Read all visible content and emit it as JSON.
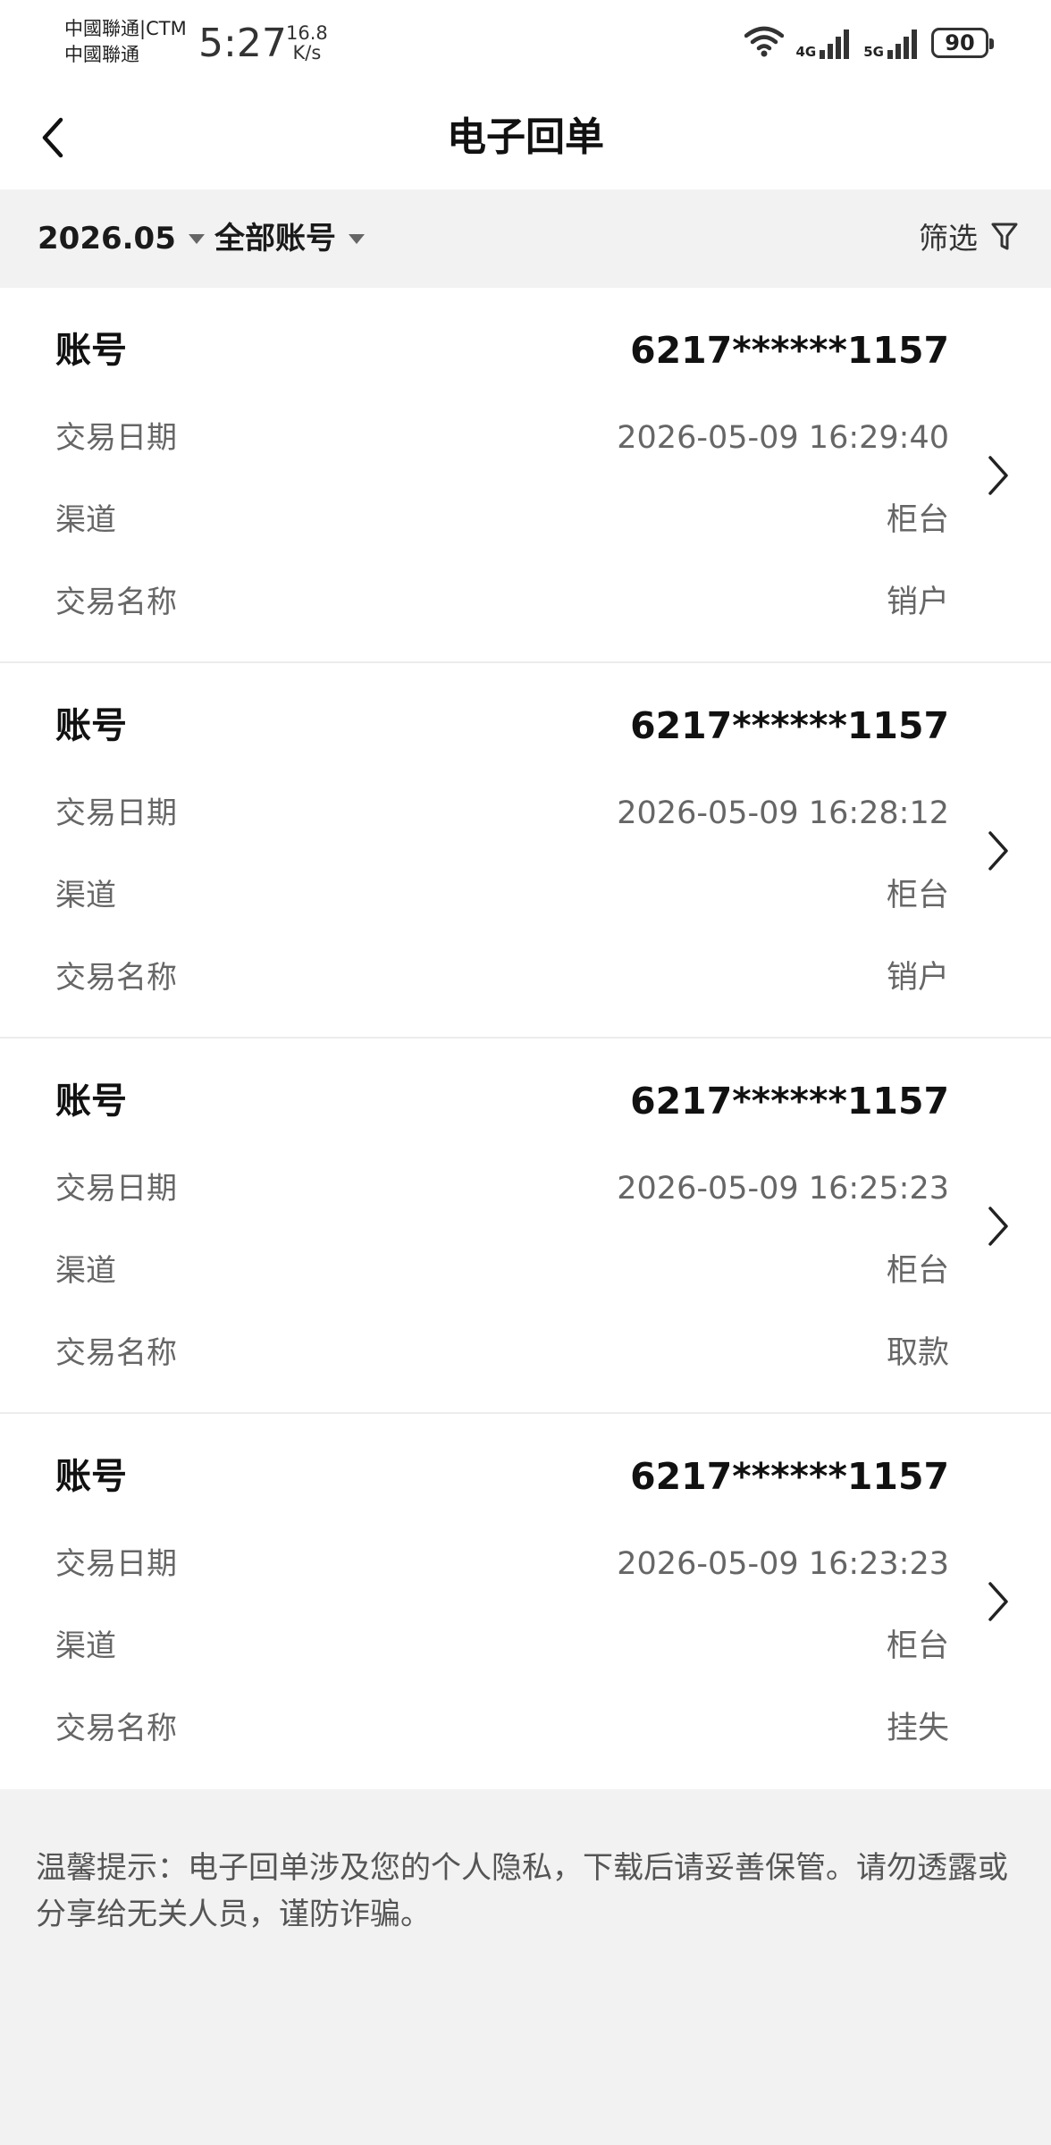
{
  "status_bar": {
    "carrier_1": "中國聯通|CTM",
    "carrier_2": "中國聯通",
    "time": "5:27",
    "speed_value": "16.8",
    "speed_unit": "K/s",
    "net_4g": "4G",
    "net_5g": "5G",
    "battery": "90"
  },
  "header": {
    "title": "电子回单"
  },
  "filters": {
    "month": "2026.05",
    "account": "全部账号",
    "filter_label": "筛选"
  },
  "labels": {
    "account": "账号",
    "date": "交易日期",
    "channel": "渠道",
    "name": "交易名称"
  },
  "records": [
    {
      "account": "6217******1157",
      "date": "2026-05-09 16:29:40",
      "channel": "柜台",
      "name": "销户"
    },
    {
      "account": "6217******1157",
      "date": "2026-05-09 16:28:12",
      "channel": "柜台",
      "name": "销户"
    },
    {
      "account": "6217******1157",
      "date": "2026-05-09 16:25:23",
      "channel": "柜台",
      "name": "取款"
    },
    {
      "account": "6217******1157",
      "date": "2026-05-09 16:23:23",
      "channel": "柜台",
      "name": "挂失"
    }
  ],
  "notice": "温馨提示：电子回单涉及您的个人隐私，下载后请妥善保管。请勿透露或分享给无关人员，谨防诈骗。",
  "colors": {
    "background": "#f2f2f2",
    "card": "#ffffff",
    "primary_text": "#111111",
    "secondary_text": "#666666"
  }
}
